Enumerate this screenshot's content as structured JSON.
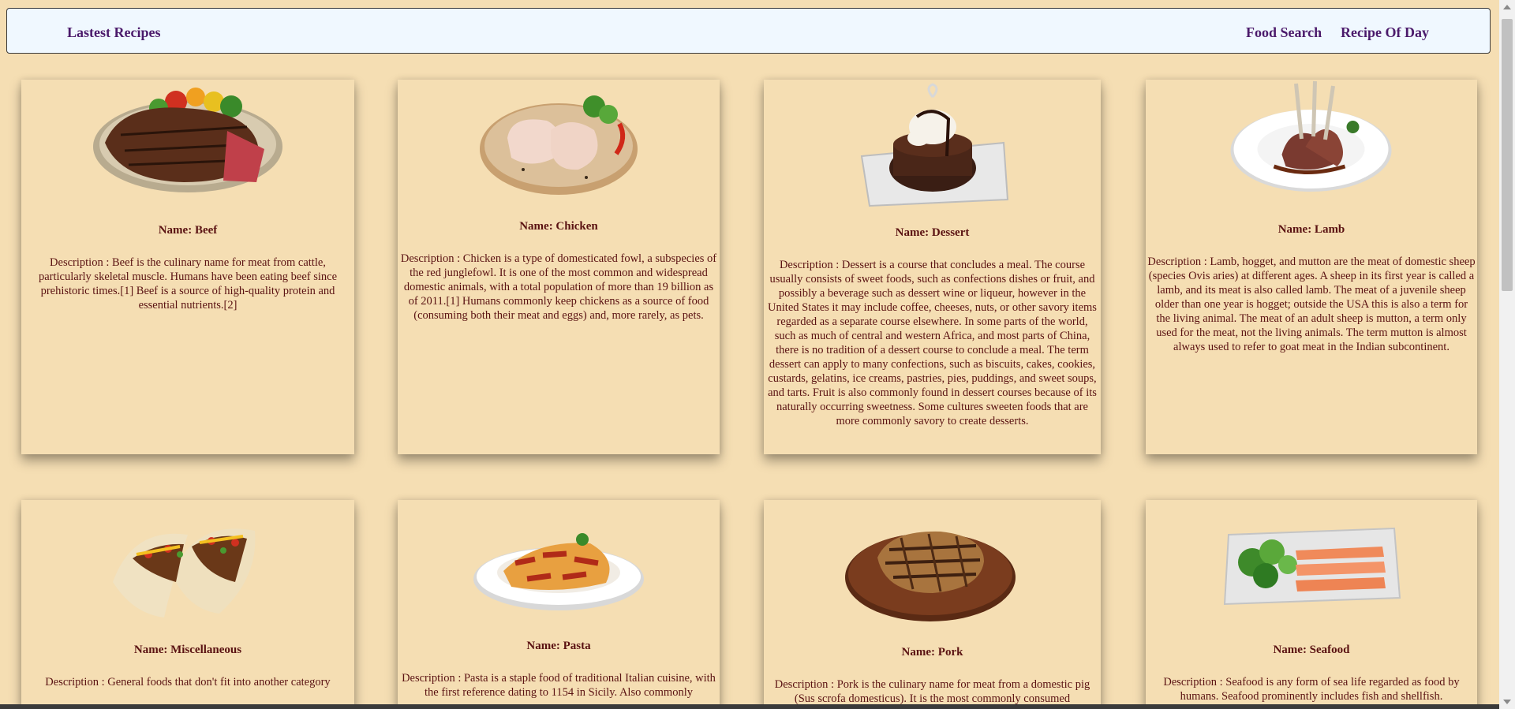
{
  "navbar": {
    "brand": "Lastest Recipes",
    "links": [
      "Food Search",
      "Recipe Of Day"
    ]
  },
  "cards": [
    {
      "image": "grilled-beef-steak-image",
      "name": "Name: Beef",
      "description": "Description : Beef is the culinary name for meat from cattle, particularly skeletal muscle. Humans have been eating beef since prehistoric times.[1] Beef is a source of high-quality protein and essential nutrients.[2]"
    },
    {
      "image": "raw-chicken-legs-image",
      "name": "Name: Chicken",
      "description": "Description : Chicken is a type of domesticated fowl, a subspecies of the red junglefowl. It is one of the most common and widespread domestic animals, with a total population of more than 19 billion as of 2011.[1] Humans commonly keep chickens as a source of food (consuming both their meat and eggs) and, more rarely, as pets."
    },
    {
      "image": "chocolate-dessert-image",
      "name": "Name: Dessert",
      "description": "Description : Dessert is a course that concludes a meal. The course usually consists of sweet foods, such as confections dishes or fruit, and possibly a beverage such as dessert wine or liqueur, however in the United States it may include coffee, cheeses, nuts, or other savory items regarded as a separate course elsewhere. In some parts of the world, such as much of central and western Africa, and most parts of China, there is no tradition of a dessert course to conclude a meal. The term dessert can apply to many confections, such as biscuits, cakes, cookies, custards, gelatins, ice creams, pastries, pies, puddings, and sweet soups, and tarts. Fruit is also commonly found in dessert courses because of its naturally occurring sweetness. Some cultures sweeten foods that are more commonly savory to create desserts."
    },
    {
      "image": "lamb-chops-image",
      "name": "Name: Lamb",
      "description": "Description : Lamb, hogget, and mutton are the meat of domestic sheep (species Ovis aries) at different ages. A sheep in its first year is called a lamb, and its meat is also called lamb. The meat of a juvenile sheep older than one year is hogget; outside the USA this is also a term for the living animal. The meat of an adult sheep is mutton, a term only used for the meat, not the living animals. The term mutton is almost always used to refer to goat meat in the Indian subcontinent."
    },
    {
      "image": "tacos-image",
      "name": "Name: Miscellaneous",
      "description": "Description : General foods that don't fit into another category"
    },
    {
      "image": "penne-pasta-image",
      "name": "Name: Pasta",
      "description": "Description : Pasta is a staple food of traditional Italian cuisine, with the first reference dating to 1154 in Sicily. Also commonly"
    },
    {
      "image": "grilled-pork-chop-image",
      "name": "Name: Pork",
      "description": "Description : Pork is the culinary name for meat from a domestic pig (Sus scrofa domesticus). It is the most commonly consumed"
    },
    {
      "image": "salmon-platter-image",
      "name": "Name: Seafood",
      "description": "Description : Seafood is any form of sea life regarded as food by humans. Seafood prominently includes fish and shellfish."
    }
  ]
}
